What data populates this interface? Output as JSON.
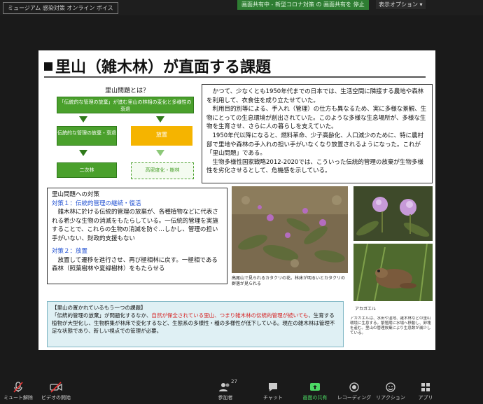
{
  "window": {
    "title": "ミュージアム 感染対策 オンライン ボイス",
    "share_banner": "画面共有中 - 新型コロナ対策 の 画面共有を 停止",
    "view_button": "表示オプション"
  },
  "slide": {
    "title": "里山（雑木林）が直面する課題",
    "diagram": {
      "heading": "里山問題とは？",
      "top_box": "「伝統的な管理の放棄」が進む里山の林相の変化と多様性の衰退",
      "left_mid": "伝統的な管理の放棄・衰退",
      "left_bottom": "二次林",
      "right_mid": "放置",
      "right_bottom": "高密度化・樹林"
    },
    "right_text": "　かつて、少なくとも1950年代までの日本では、生活空間に隣接する農地や森林を利用して、衣食住を成り立たせていた。\n　利用目的別等による、手入れ（管理）の仕方も異なるため、実に多様な景観、生物にとっての生息環境が創出されていた。このような多様な生息場所が、多様な生物を生育させ、さらに人の暮らしを支えていた。\n　1950年代以降になると、燃料革命、少子高齢化、人口減少のために、特に農村部で里地や森林の手入れの担い手がいなくなり放置されるようになった。これが「里山問題」である。\n　生物多様性国家戦略2012-2020では、こういった伝統的管理の放棄が生物多様性を劣化させるとして、危機感を示している。",
    "left_box": {
      "heading": "里山問題への対策",
      "sub1": "対策１：伝統的管理の継続・復活",
      "body1": "　雑木林に於ける伝統的管理の放棄が、各種植物などに代表される希少な生物の消滅をもたらしている。一伝統的管理を実施することで、これらの生物の消滅を防ぐ…しかし、管理の担い手がいない、財政的支援もない",
      "sub2": "対策２：放置",
      "body2": "　放置して遷移を進行させ、再び極相林に戻す。一極相である森林（照葉樹林や夏緑樹林）をもたらせる"
    },
    "photo_caption": "高尾山で見られるカタクリの花。林床が明るいとカタクリの群落が見られる",
    "frog_caption": "アカガエル",
    "bottom_box": {
      "heading": "【里山の置かれているもう一つの課題】",
      "body_black_1": "「伝統的管理の放棄」が問題化するなか、",
      "body_red": "自然が保全されている里山、つまり雑木林の伝統的管理が続いても",
      "body_black_2": "、生育する植物が大型化し、生物群集が林床で変化するなど、生態系の多様性・種の多様性が低下している。現在の雑木林は管理不足な状態であり、新しい視点での管理が必要。"
    },
    "panel_text": "アカガエルは、水田や湿地、雑木林などの里山環境に生息する。繁殖期に水場へ移動し、卵塊を産む。里山の管理放棄により生息数が減少している。"
  },
  "toolbar": {
    "items": [
      {
        "label": "ミュート解除"
      },
      {
        "label": "ビデオの開始"
      },
      {
        "label": "参加者"
      },
      {
        "label": "チャット"
      },
      {
        "label": "画面の共有"
      },
      {
        "label": "レコーディング"
      },
      {
        "label": "リアクション"
      },
      {
        "label": "アプリ"
      }
    ],
    "participants_count": "27"
  },
  "colors": {
    "accent_green": "#4aa02c",
    "accent_orange": "#f5b400",
    "emphasis_blue": "#1f4fd1",
    "emphasis_red": "#d62020"
  }
}
